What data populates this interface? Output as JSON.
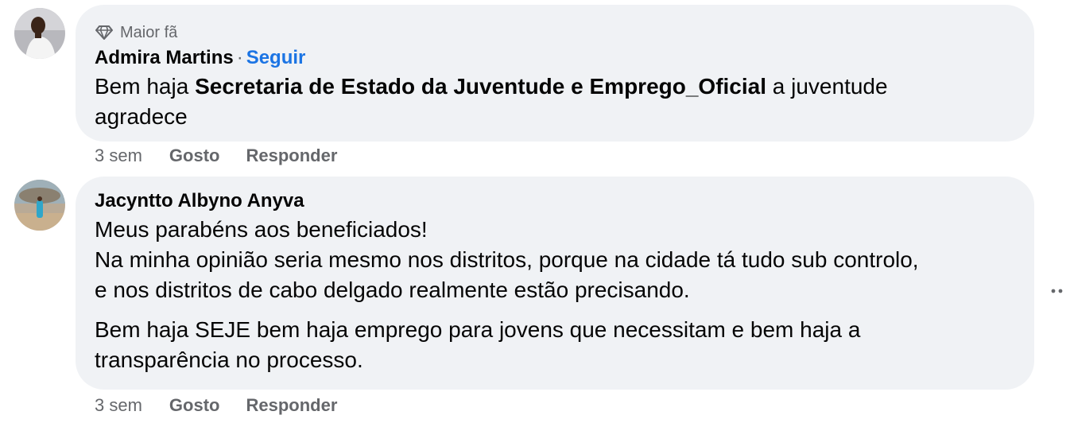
{
  "comments": [
    {
      "badge": "Maior fã",
      "badge_icon": "diamond-icon",
      "author": "Admira Martins",
      "separator": "·",
      "follow_label": "Seguir",
      "text_before": "Bem haja ",
      "text_bold": "Secretaria de Estado da Juventude e Emprego_Oficial",
      "text_after_line1": " a juventude",
      "text_line2": "agradece",
      "time": "3 sem",
      "like_label": "Gosto",
      "reply_label": "Responder"
    },
    {
      "author": "Jacyntto Albyno Anyva",
      "lines": [
        "Meus parabéns aos beneficiados!",
        "Na minha opinião seria mesmo nos distritos, porque na cidade tá tudo sub controlo,",
        "e nos distritos de cabo delgado realmente estão precisando."
      ],
      "paragraph2_lines": [
        "Bem haja SEJE bem haja emprego para jovens que necessitam e bem haja a",
        "transparência no processo."
      ],
      "time": "3 sem",
      "like_label": "Gosto",
      "reply_label": "Responder"
    }
  ],
  "more_options_icon": "ellipsis-icon",
  "colors": {
    "bubble_bg": "#f0f2f5",
    "secondary_text": "#65676b",
    "link_blue": "#1b74e4"
  }
}
